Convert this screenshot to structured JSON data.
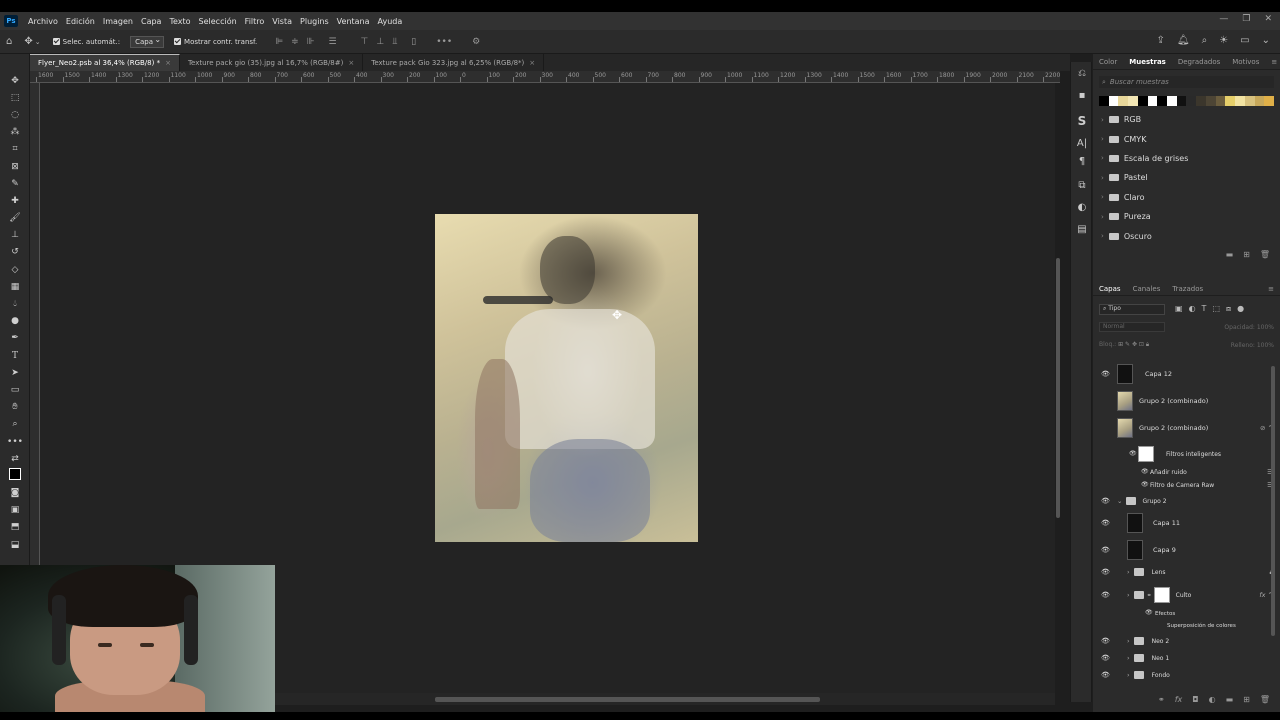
{
  "app": {
    "logo": "Ps"
  },
  "menu": [
    "Archivo",
    "Edición",
    "Imagen",
    "Capa",
    "Texto",
    "Selección",
    "Filtro",
    "Vista",
    "Plugins",
    "Ventana",
    "Ayuda"
  ],
  "window_controls": {
    "min": "—",
    "restore": "❐",
    "close": "✕"
  },
  "options": {
    "auto_select_label": "Selec. automát.:",
    "auto_select_target": "Capa",
    "show_transform_label": "Mostrar contr. transf.",
    "more": "•••"
  },
  "tabs": [
    {
      "label": "Flyer_Neo2.psb al 36,4% (RGB/8) *",
      "active": true
    },
    {
      "label": "Texture pack gio (35).jpg al 16,7% (RGB/8#)",
      "active": false
    },
    {
      "label": "Texture pack Gio 323.jpg al 6,25% (RGB/8*)",
      "active": false
    }
  ],
  "ruler": {
    "labels": [
      "1600",
      "1500",
      "1400",
      "1300",
      "1200",
      "1100",
      "1000",
      "900",
      "800",
      "700",
      "600",
      "500",
      "400",
      "300",
      "200",
      "100",
      "0",
      "100",
      "200",
      "300",
      "400",
      "500",
      "600",
      "700",
      "800",
      "900",
      "1000",
      "1100",
      "1200",
      "1300",
      "1400",
      "1500",
      "1600",
      "1700",
      "1800",
      "1900",
      "2000",
      "2100",
      "2200"
    ]
  },
  "swatches_panel": {
    "tabs": [
      "Color",
      "Muestras",
      "Degradados",
      "Motivos"
    ],
    "active_tab": "Muestras",
    "search_placeholder": "Buscar muestras",
    "swatch_colors": [
      "#000000",
      "#ffffff",
      "#e8d79a",
      "#f3e6b4",
      "#000000",
      "#ffffff",
      "#000000",
      "#ffffff",
      "#111111",
      "#2a2a2a",
      "#3b362c",
      "#4d4535",
      "#6b5d3e",
      "#e6cf6a",
      "#f2e3a2",
      "#d8c27e",
      "#c7a85a",
      "#e0b048"
    ],
    "folders": [
      "RGB",
      "CMYK",
      "Escala de grises",
      "Pastel",
      "Claro",
      "Pureza",
      "Oscuro"
    ]
  },
  "layers_panel": {
    "tabs": [
      "Capas",
      "Canales",
      "Trazados"
    ],
    "active_tab": "Capas",
    "filter_kind": "Tipo",
    "blend_mode": "Normal",
    "opacity_label": "Opacidad:",
    "opacity_value": "100%",
    "lock_label": "Bloq.:",
    "fill_label": "Relleno:",
    "fill_value": "100%",
    "layers": [
      {
        "name": "Capa 12",
        "visible": true,
        "thumb": "dark"
      },
      {
        "name": "Grupo 2 (combinado)",
        "visible": false,
        "thumb": "img"
      },
      {
        "name": "Grupo 2 (combinado)",
        "visible": false,
        "thumb": "img"
      },
      {
        "name": "Filtros inteligentes",
        "visible": true,
        "thumb": "white"
      },
      {
        "name": "Añadir ruido",
        "visible": true
      },
      {
        "name": "Filtro de Camera Raw",
        "visible": true
      },
      {
        "name": "Grupo 2",
        "visible": true,
        "type": "group"
      },
      {
        "name": "Capa 11",
        "visible": true,
        "thumb": "dark"
      },
      {
        "name": "Capa 9",
        "visible": true,
        "thumb": "dark"
      },
      {
        "name": "Lens",
        "visible": true,
        "type": "group"
      },
      {
        "name": "Culto",
        "visible": true,
        "type": "group-masked"
      },
      {
        "name": "Efectos",
        "visible": true
      },
      {
        "name": "Superposición de colores",
        "visible": true
      },
      {
        "name": "Neo 2",
        "visible": true,
        "type": "group"
      },
      {
        "name": "Neo 1",
        "visible": true,
        "type": "group"
      },
      {
        "name": "Fondo",
        "visible": true,
        "type": "group"
      }
    ]
  }
}
